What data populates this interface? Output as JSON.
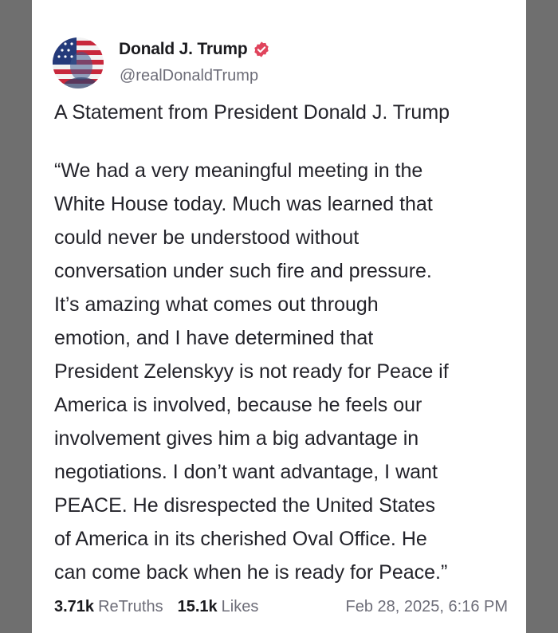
{
  "author": {
    "display_name": "Donald J. Trump",
    "handle": "@realDonaldTrump",
    "verified_icon": "verified-badge-icon",
    "verified_color": "#e0445c"
  },
  "post": {
    "title": "A Statement from President Donald J. Trump",
    "body": "“We had a very meaningful meeting in the\nWhite House today. Much was learned that\ncould never be understood without\nconversation under such fire and pressure.\nIt’s amazing what comes out through\nemotion, and I have determined that\nPresident Zelenskyy is not ready for Peace if\nAmerica is involved, because he feels our\ninvolvement gives him a big advantage in\nnegotiations. I don’t want advantage, I want\nPEACE. He disrespected the United States\nof America in its cherished Oval Office. He\ncan come back when he is ready for Peace.”"
  },
  "stats": {
    "retruths_count": "3.71k",
    "retruths_label": "ReTruths",
    "likes_count": "15.1k",
    "likes_label": "Likes",
    "timestamp": "Feb 28, 2025, 6:16 PM"
  }
}
